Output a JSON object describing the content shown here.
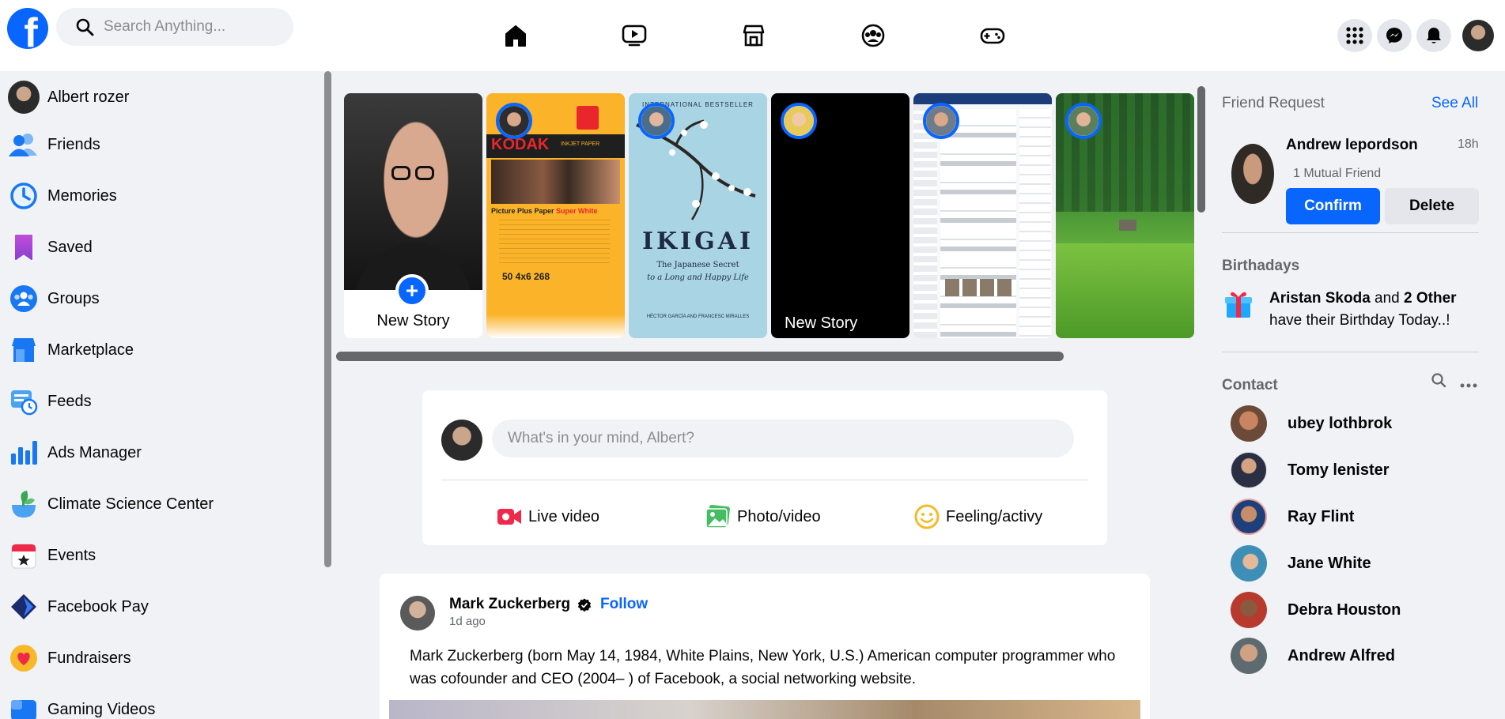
{
  "topbar": {
    "logo": "f",
    "search_placeholder": "Search Anything...",
    "nav_icons": [
      "home-icon",
      "watch-icon",
      "marketplace-icon",
      "groups-icon",
      "gaming-icon"
    ],
    "right_icons": [
      "menu-grid-icon",
      "messenger-icon",
      "notifications-icon"
    ]
  },
  "sidebar": {
    "items": [
      {
        "label": "Albert rozer",
        "icon": "profile-avatar"
      },
      {
        "label": "Friends",
        "icon": "friends-icon"
      },
      {
        "label": "Memories",
        "icon": "memories-icon"
      },
      {
        "label": "Saved",
        "icon": "saved-icon"
      },
      {
        "label": "Groups",
        "icon": "groups-icon"
      },
      {
        "label": "Marketplace",
        "icon": "marketplace-icon"
      },
      {
        "label": "Feeds",
        "icon": "feeds-icon"
      },
      {
        "label": "Ads Manager",
        "icon": "ads-manager-icon"
      },
      {
        "label": "Climate Science Center",
        "icon": "climate-icon"
      },
      {
        "label": "Events",
        "icon": "events-icon"
      },
      {
        "label": "Facebook Pay",
        "icon": "facebook-pay-icon"
      },
      {
        "label": "Fundraisers",
        "icon": "fundraisers-icon"
      },
      {
        "label": "Gaming Videos",
        "icon": "gaming-videos-icon"
      }
    ]
  },
  "stories": {
    "new_story_label": "New Story",
    "new_story_label_2": "New Story",
    "book_title": "IKIGAI",
    "book_subtitle_1": "The Japanese Secret",
    "book_subtitle_2": "to a Long and Happy Life",
    "book_top": "INTERNATIONAL BESTSELLER",
    "book_authors": "HÉCTOR GARCÍA AND FRANCESC MIRALLES",
    "kodak_brand": "KODAK",
    "kodak_sub": "INKJET PAPER",
    "kodak_line": "Picture Plus Paper",
    "kodak_line2": "Super White",
    "kodak_nums": "50  4x6  268"
  },
  "composer": {
    "placeholder": "What's in your mind, Albert?",
    "actions": [
      "Live video",
      "Photo/video",
      "Feeling/activy"
    ]
  },
  "post": {
    "author": "Mark Zuckerberg",
    "follow_label": "Follow",
    "time": "1d ago",
    "text": "Mark Zuckerberg (born May 14, 1984, White Plains, New York, U.S.) American computer programmer who was cofounder and CEO (2004– ) of Facebook, a social networking website."
  },
  "right": {
    "friend_request_title": "Friend Request",
    "see_all": "See All",
    "request": {
      "name": "Andrew lepordson",
      "time": "18h",
      "mutual": "1 Mutual Friend",
      "confirm": "Confirm",
      "delete": "Delete"
    },
    "birthdays_title": "Birthadays",
    "birthday_name": "Aristan Skoda",
    "birthday_and": " and ",
    "birthday_others": "2 Other",
    "birthday_line2": "have their Birthday Today..!",
    "contact_title": "Contact",
    "contacts": [
      "ubey lothbrok",
      "Tomy lenister",
      "Ray Flint",
      "Jane White",
      "Debra Houston",
      "Andrew Alfred"
    ]
  },
  "colors": {
    "brand": "#0866ff",
    "background": "#f0f2f5"
  }
}
